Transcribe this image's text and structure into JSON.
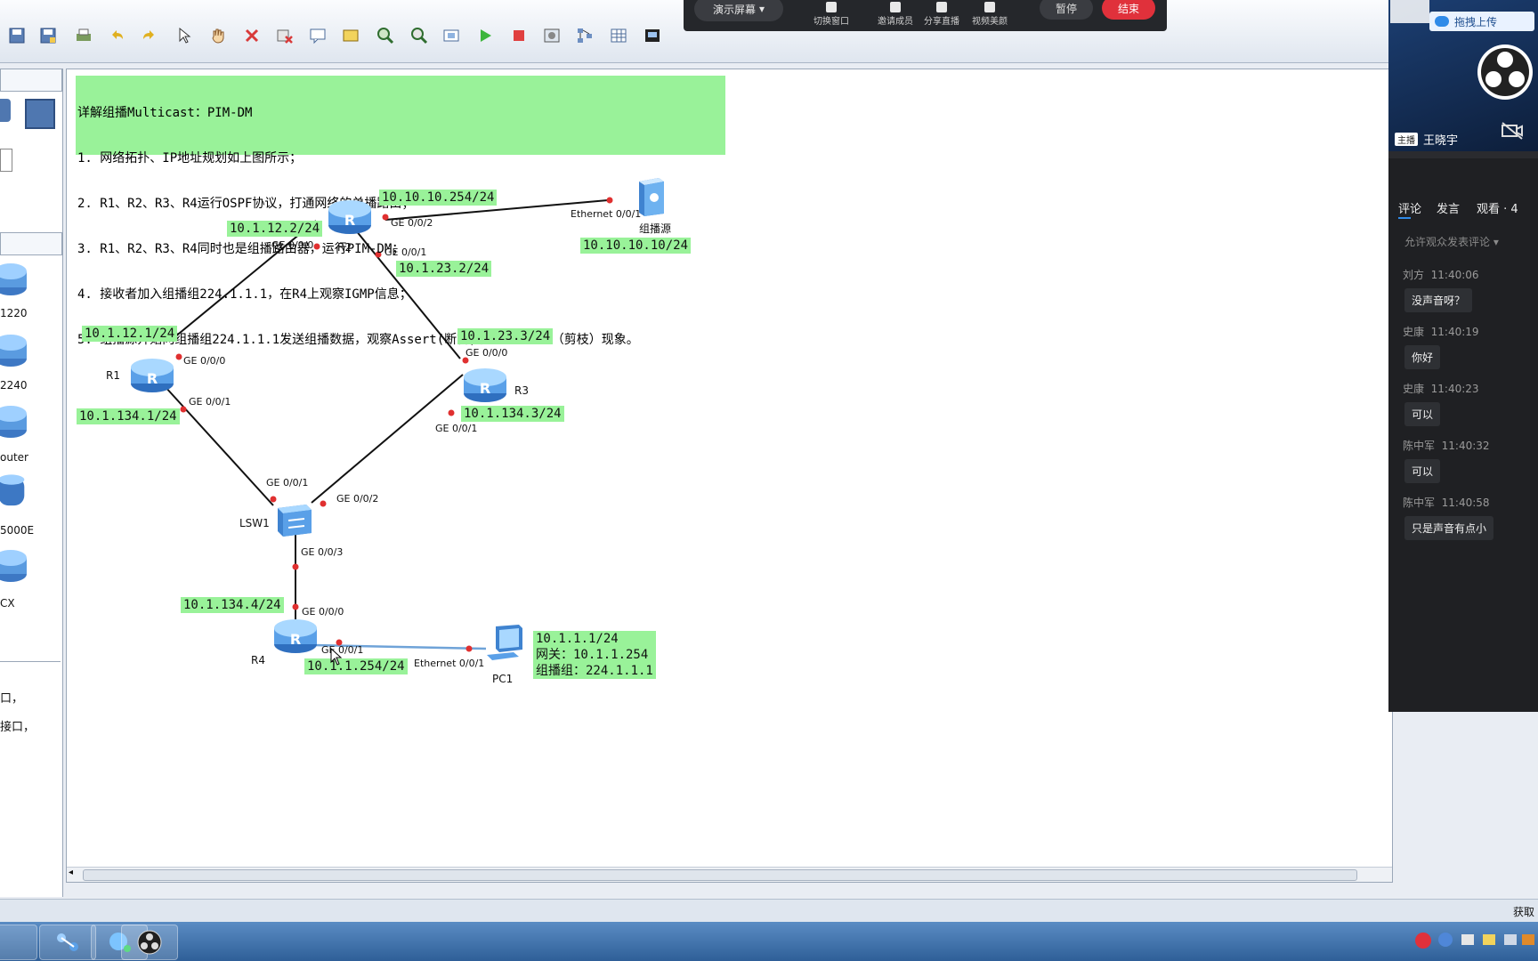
{
  "toolbar": {
    "buttons": [
      "save-icon",
      "save-as-icon",
      "print-icon",
      "undo-icon",
      "redo-icon",
      "select-icon",
      "hand-icon",
      "delete-icon",
      "remove-link-icon",
      "text-note-icon",
      "rectangle-icon",
      "zoom-in-icon",
      "zoom-out-icon",
      "fit-icon",
      "start-icon",
      "stop-icon",
      "capture-icon",
      "topology-icon",
      "grid-icon",
      "screenshot-icon"
    ]
  },
  "left_panel": {
    "devices": [
      {
        "label": "1220",
        "icon": "router-icon"
      },
      {
        "label": "2240",
        "icon": "router-icon"
      },
      {
        "label": "outer",
        "icon": "router-icon"
      },
      {
        "label": "5000E",
        "icon": "firewall-icon"
      },
      {
        "label": "CX",
        "icon": "cx-router-icon"
      }
    ],
    "desc_lines": [
      "口，",
      "接口，"
    ]
  },
  "note": {
    "lines": [
      "详解组播Multicast：PIM-DM",
      "1. 网络拓扑、IP地址规划如上图所示；",
      "2. R1、R2、R3、R4运行OSPF协议，打通网络的单播路由；",
      "3. R1、R2、R3、R4同时也是组播路由器，运行PIM-DM；",
      "4. 接收者加入组播组224.1.1.1，在R4上观察IGMP信息；",
      "5. 组播源开始向组播组224.1.1.1发送组播数据，观察Assert(断言)现象、Prune（剪枝）现象。"
    ]
  },
  "topology": {
    "nodes": {
      "r1": "R1",
      "r2": "R2",
      "r3": "R3",
      "r4": "R4",
      "lsw1": "LSW1",
      "source": "组播源",
      "pc1": "PC1"
    },
    "ip_labels": {
      "r2_ge002": "10.10.10.254/24",
      "r2_ge000": "10.1.12.2/24",
      "r2_ge001": "10.1.23.2/24",
      "source_ip": "10.10.10.10/24",
      "r1_ge000": "10.1.12.1/24",
      "r1_ge001": "10.1.134.1/24",
      "r3_ge000": "10.1.23.3/24",
      "r3_ge001": "10.1.134.3/24",
      "r4_ge000": "10.1.134.4/24",
      "r4_ge001": "10.1.1.254/24",
      "pc1_ip": "10.1.1.1/24",
      "pc1_gw": "网关：10.1.1.254",
      "pc1_group": "组播组：224.1.1.1"
    },
    "ports": {
      "r2_p002": "GE 0/0/2",
      "source_eth": "Ethernet 0/0/1",
      "r2_p000": "GE 0/0/0",
      "r2_p001": "GE 0/0/1",
      "r1_p000": "GE 0/0/0",
      "r1_p001": "GE 0/0/1",
      "r3_p000": "GE 0/0/0",
      "r3_p001": "GE 0/0/1",
      "lsw_p001": "GE 0/0/1",
      "lsw_p002": "GE 0/0/2",
      "lsw_p003": "GE 0/0/3",
      "r4_p000": "GE 0/0/0",
      "r4_p001": "GE 0/0/1",
      "pc1_eth": "Ethernet 0/0/1"
    }
  },
  "meeting_bar": {
    "present": "演示屏幕",
    "switch": "切换窗口",
    "invite": "邀请成员",
    "share": "分享直播",
    "beauty": "视频美颜",
    "pause": "暂停",
    "end": "结束"
  },
  "right_panel": {
    "upload": "拖拽上传",
    "host_badge": "主播",
    "host_name": "王晓宇",
    "tabs": {
      "comment": "评论",
      "speak": "发言",
      "viewers": "观看 · 4"
    },
    "allow_comments": "允许观众发表评论",
    "comments": [
      {
        "user": "刘方",
        "time": "11:40:06",
        "text": "没声音呀？"
      },
      {
        "user": "史康",
        "time": "11:40:19",
        "text": "你好"
      },
      {
        "user": "史康",
        "time": "11:40:23",
        "text": "可以"
      },
      {
        "user": "陈中军",
        "time": "11:40:32",
        "text": "可以"
      },
      {
        "user": "陈中军",
        "time": "11:40:58",
        "text": "只是声音有点小"
      }
    ]
  },
  "statusbar": {
    "right_text": "获取"
  },
  "colors": {
    "label_bg": "#99f299",
    "end_button": "#e0313b",
    "link": "#111111",
    "pc_link": "#6fa3d8",
    "port_dot": "#e03030"
  }
}
